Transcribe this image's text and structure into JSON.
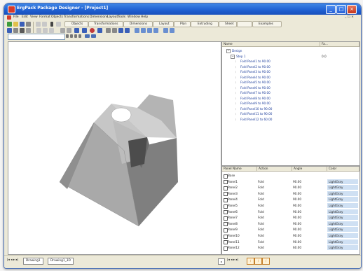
{
  "window": {
    "title": "ErgPack Package Designer - [Project1]",
    "min": "_",
    "max": "□",
    "close": "×"
  },
  "menu": [
    "File",
    "Edit",
    "View",
    "Format",
    "Objects",
    "Transformations",
    "Dimensions",
    "Layout",
    "Tools",
    "Window",
    "Help"
  ],
  "mdi_controls": "_ ☐ ×",
  "toolbar1": {
    "objects": "Objects",
    "transformations": "Transformations",
    "dimensions": "Dimensions",
    "layout": "Layout",
    "plan": "Plan",
    "extrude": "Extruding",
    "sheet": "Sheet",
    "examples": "Examples"
  },
  "address": {
    "value": ""
  },
  "tree": {
    "headers": {
      "name": "Name",
      "value": "Fa..."
    },
    "rows": [
      {
        "indent": 0,
        "label": "Design",
        "exp": "−",
        "value": ""
      },
      {
        "indent": 1,
        "label": "Step 1",
        "exp": "−",
        "value": "0.0"
      },
      {
        "indent": 2,
        "label": "Fold Panel1 to 90.00",
        "exp": "",
        "value": ""
      },
      {
        "indent": 2,
        "label": "Fold Panel2 to 90.00",
        "exp": "",
        "value": ""
      },
      {
        "indent": 2,
        "label": "Fold Panel3 to 90.00",
        "exp": "",
        "value": ""
      },
      {
        "indent": 2,
        "label": "Fold Panel4 to 90.00",
        "exp": "",
        "value": ""
      },
      {
        "indent": 2,
        "label": "Fold Panel5 to 90.00",
        "exp": "",
        "value": ""
      },
      {
        "indent": 2,
        "label": "Fold Panel6 to 90.00",
        "exp": "",
        "value": ""
      },
      {
        "indent": 2,
        "label": "Fold Panel7 to 90.00",
        "exp": "",
        "value": ""
      },
      {
        "indent": 2,
        "label": "Fold Panel8 to 90.00",
        "exp": "",
        "value": ""
      },
      {
        "indent": 2,
        "label": "Fold Panel9 to 90.00",
        "exp": "",
        "value": ""
      },
      {
        "indent": 2,
        "label": "Fold Panel10 to 90.00",
        "exp": "",
        "value": ""
      },
      {
        "indent": 2,
        "label": "Fold Panel11 to 90.00",
        "exp": "",
        "value": ""
      },
      {
        "indent": 2,
        "label": "Fold Panel12 to 60.00",
        "exp": "",
        "value": ""
      }
    ]
  },
  "props": {
    "headers": [
      "Panel Name",
      "Action",
      "Angle",
      "Color"
    ],
    "rows": [
      [
        "Base",
        "",
        "",
        ""
      ],
      [
        "Panel1",
        "Fold",
        "90.00",
        "LightGray"
      ],
      [
        "Panel2",
        "Fold",
        "90.00",
        "LightGray"
      ],
      [
        "Panel3",
        "Fold",
        "90.00",
        "LightGray"
      ],
      [
        "Panel4",
        "Fold",
        "90.00",
        "LightGray"
      ],
      [
        "Panel5",
        "Fold",
        "90.00",
        "LightGray"
      ],
      [
        "Panel6",
        "Fold",
        "90.00",
        "LightGray"
      ],
      [
        "Panel7",
        "Fold",
        "90.00",
        "LightGray"
      ],
      [
        "Panel8",
        "Fold",
        "90.00",
        "LightGray"
      ],
      [
        "Panel9",
        "Fold",
        "90.00",
        "LightGray"
      ],
      [
        "Panel10",
        "Fold",
        "90.00",
        "LightGray"
      ],
      [
        "Panel11",
        "Fold",
        "90.00",
        "LightGray"
      ],
      [
        "Panel12",
        "Fold",
        "60.00",
        "LightGray"
      ]
    ]
  },
  "statusbar": {
    "nav": "|◂ ◂ ▸ ▸|",
    "tab1": "Drawing1",
    "tab2": "Drawing1_3D",
    "right_nav": "|◂ ◂ ▸ ▸|"
  },
  "colors": {
    "title_blue": "#1f5fd1",
    "panel_light": "#cfcfcf",
    "panel_mid": "#a9a9a9",
    "panel_dark": "#7a7a7a",
    "panel_shadow": "#4c4c4c",
    "selection_blue": "#cfe0f3"
  }
}
